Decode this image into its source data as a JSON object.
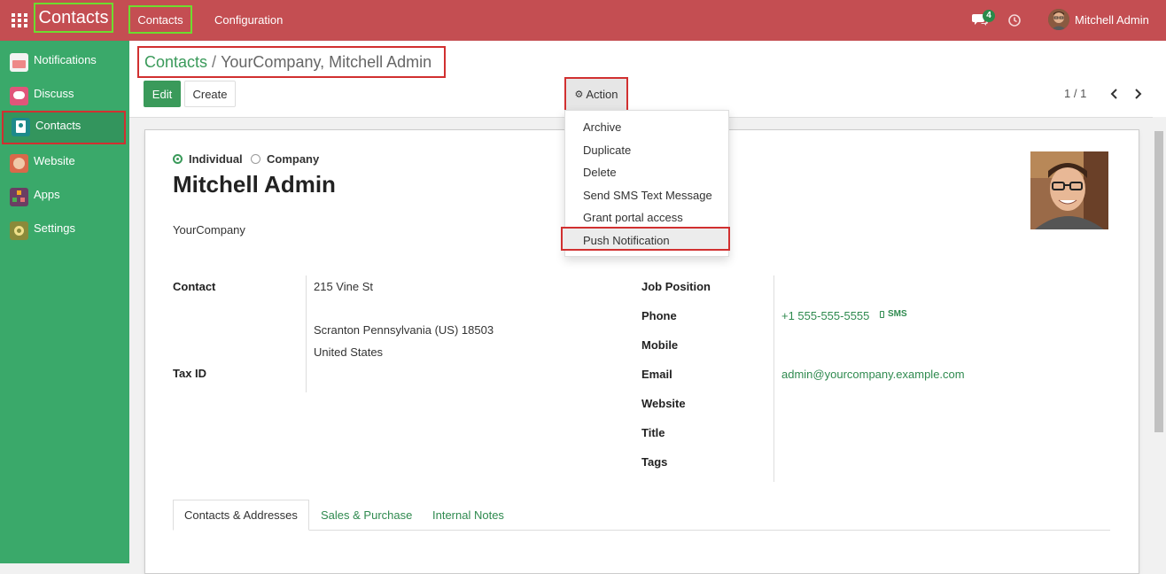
{
  "topbar": {
    "app_title": "Contacts",
    "menu": [
      "Contacts",
      "Configuration"
    ],
    "chat_badge": "4",
    "user_name": "Mitchell Admin",
    "color": "#c44e52"
  },
  "sidebar": {
    "color": "#3aa96a",
    "items": [
      {
        "label": "Notifications",
        "icon": "notifications-icon"
      },
      {
        "label": "Discuss",
        "icon": "discuss-icon"
      },
      {
        "label": "Contacts",
        "icon": "contacts-icon"
      },
      {
        "label": "Website",
        "icon": "website-icon"
      },
      {
        "label": "Apps",
        "icon": "apps-icon"
      },
      {
        "label": "Settings",
        "icon": "settings-icon"
      }
    ]
  },
  "breadcrumb": {
    "parent": "Contacts",
    "separator": "/",
    "current": "YourCompany, Mitchell Admin"
  },
  "buttons": {
    "edit": "Edit",
    "create": "Create",
    "action": "Action"
  },
  "pager": "1 / 1",
  "action_menu": [
    "Archive",
    "Duplicate",
    "Delete",
    "Send SMS Text Message",
    "Grant portal access",
    "Push Notification"
  ],
  "form": {
    "type_options": [
      "Individual",
      "Company"
    ],
    "selected_type": "Individual",
    "name": "Mitchell Admin",
    "company": "YourCompany",
    "left_fields": {
      "contact_label": "Contact",
      "street": "215 Vine St",
      "city_line": "Scranton  Pennsylvania (US)  18503",
      "country": "United States",
      "tax_id_label": "Tax ID"
    },
    "right_fields": {
      "job_position_label": "Job Position",
      "phone_label": "Phone",
      "phone": "+1 555-555-5555",
      "sms": "SMS",
      "mobile_label": "Mobile",
      "email_label": "Email",
      "email": "admin@yourcompany.example.com",
      "website_label": "Website",
      "title_label": "Title",
      "tags_label": "Tags"
    }
  },
  "tabs": [
    "Contacts & Addresses",
    "Sales & Purchase",
    "Internal Notes"
  ]
}
